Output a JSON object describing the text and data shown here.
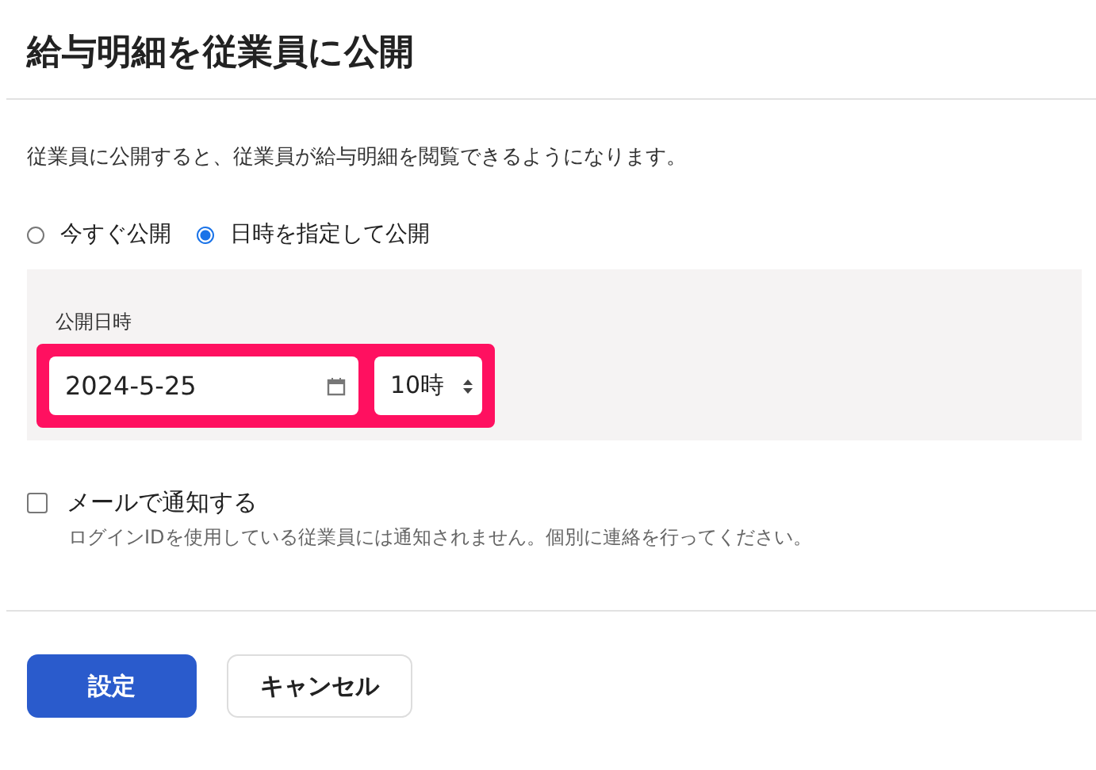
{
  "title": "給与明細を従業員に公開",
  "description": "従業員に公開すると、従業員が給与明細を閲覧できるようになります。",
  "publish_options": [
    {
      "label": "今すぐ公開",
      "selected": false
    },
    {
      "label": "日時を指定して公開",
      "selected": true
    }
  ],
  "schedule": {
    "label": "公開日時",
    "date": "2024-5-25",
    "hour": "10時",
    "highlighted": true
  },
  "notify": {
    "label": "メールで通知する",
    "checked": false,
    "hint": "ログインIDを使用している従業員には通知されません。個別に連絡を行ってください。"
  },
  "buttons": [
    {
      "label": "設定",
      "kind": "primary"
    },
    {
      "label": "キャンセル",
      "kind": "secondary"
    }
  ]
}
